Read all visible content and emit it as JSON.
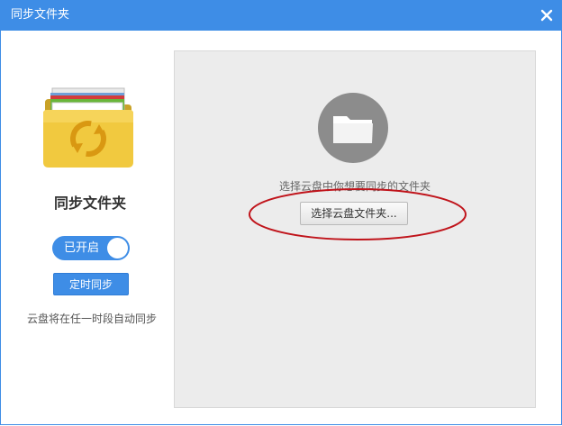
{
  "window": {
    "title": "同步文件夹",
    "close_icon": "close-icon"
  },
  "left": {
    "icon": "folder-sync-icon",
    "title": "同步文件夹",
    "toggle_label": "已开启",
    "toggle_state": "on",
    "schedule_button": "定时同步",
    "hint": "云盘将在任一时段自动同步"
  },
  "main": {
    "icon": "folder-icon",
    "prompt": "选择云盘中你想要同步的文件夹",
    "select_button": "选择云盘文件夹..."
  },
  "colors": {
    "accent": "#3e8de6",
    "annotation": "#c0141b",
    "panel_bg": "#ececec"
  }
}
